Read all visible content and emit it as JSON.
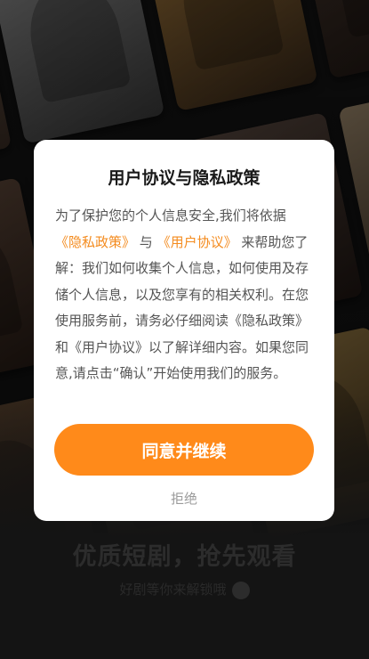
{
  "background": {
    "slogan": "优质短剧，抢先观看",
    "sub_slogan": "好剧等你来解锁哦"
  },
  "dialog": {
    "title": "用户协议与隐私政策",
    "body": {
      "part1": "为了保护您的个人信息安全,我们将依据",
      "privacy_link": "《隐私政策》",
      "part2": "与",
      "user_agreement_link": "《用户协议》",
      "part3": "来帮助您了解：我们如何收集个人信息，如何使用及存储个人信息，以及您享有的相关权利。在您使用服务前，请务必仔细阅读《隐私政策》和《用户协议》以了解详细内容。如果您同意,请点击“确认”开始使用我们的服务。"
    },
    "agree_label": "同意并继续",
    "reject_label": "拒绝"
  },
  "colors": {
    "accent": "#ff8a1a",
    "link": "#f48b1e"
  }
}
